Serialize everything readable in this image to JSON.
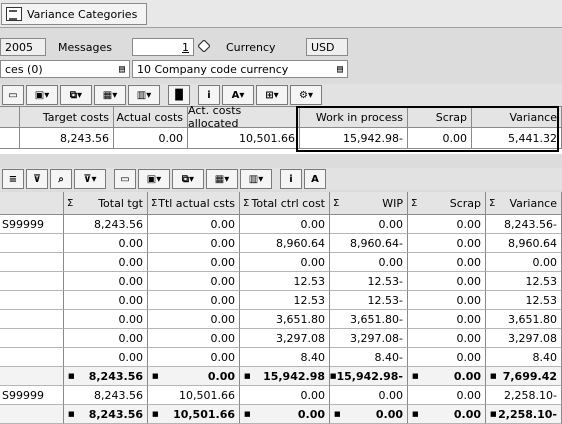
{
  "topbar": {
    "title": "Variance Categories"
  },
  "params": {
    "year": "2005",
    "messages_label": "Messages",
    "messages_value": "1",
    "currency_label": "Currency",
    "currency_value": "USD",
    "variances_field": "ces (0)",
    "currency_type": "10 Company code currency"
  },
  "summary": {
    "headers": [
      "Target costs",
      "Actual costs",
      "Act. costs allocated",
      "Work in process",
      "Scrap",
      "Variance"
    ],
    "values": [
      "8,243.56",
      "0.00",
      "10,501.66",
      "15,942.98-",
      "0.00",
      "5,441.32"
    ]
  },
  "grid": {
    "headers": [
      "Total tgt",
      "Ttl actual csts",
      "Total ctrl cost",
      "WIP",
      "Scrap",
      "Variance"
    ],
    "rows": [
      [
        "S99999",
        "8,243.56",
        "0.00",
        "0.00",
        "0.00",
        "0.00",
        "8,243.56-"
      ],
      [
        "",
        "0.00",
        "0.00",
        "8,960.64",
        "8,960.64-",
        "0.00",
        "8,960.64"
      ],
      [
        "",
        "0.00",
        "0.00",
        "0.00",
        "0.00",
        "0.00",
        "0.00"
      ],
      [
        "",
        "0.00",
        "0.00",
        "12.53",
        "12.53-",
        "0.00",
        "12.53"
      ],
      [
        "",
        "0.00",
        "0.00",
        "12.53",
        "12.53-",
        "0.00",
        "12.53"
      ],
      [
        "",
        "0.00",
        "0.00",
        "3,651.80",
        "3,651.80-",
        "0.00",
        "3,651.80"
      ],
      [
        "",
        "0.00",
        "0.00",
        "3,297.08",
        "3,297.08-",
        "0.00",
        "3,297.08"
      ],
      [
        "",
        "0.00",
        "0.00",
        "8.40",
        "8.40-",
        "0.00",
        "8.40"
      ]
    ],
    "subtotal": [
      "",
      "8,243.56",
      "0.00",
      "15,942.98",
      "15,942.98-",
      "0.00",
      "7,699.42"
    ],
    "row2": [
      "S99999",
      "8,243.56",
      "10,501.66",
      "0.00",
      "0.00",
      "0.00",
      "2,258.10-"
    ],
    "total": [
      "",
      "8,243.56",
      "10,501.66",
      "0.00",
      "0.00",
      "0.00",
      "2,258.10-"
    ]
  },
  "colors": {
    "highlight_border": "#000000",
    "header_bg": "#e4e4e4",
    "background": "#dcdcdc"
  }
}
